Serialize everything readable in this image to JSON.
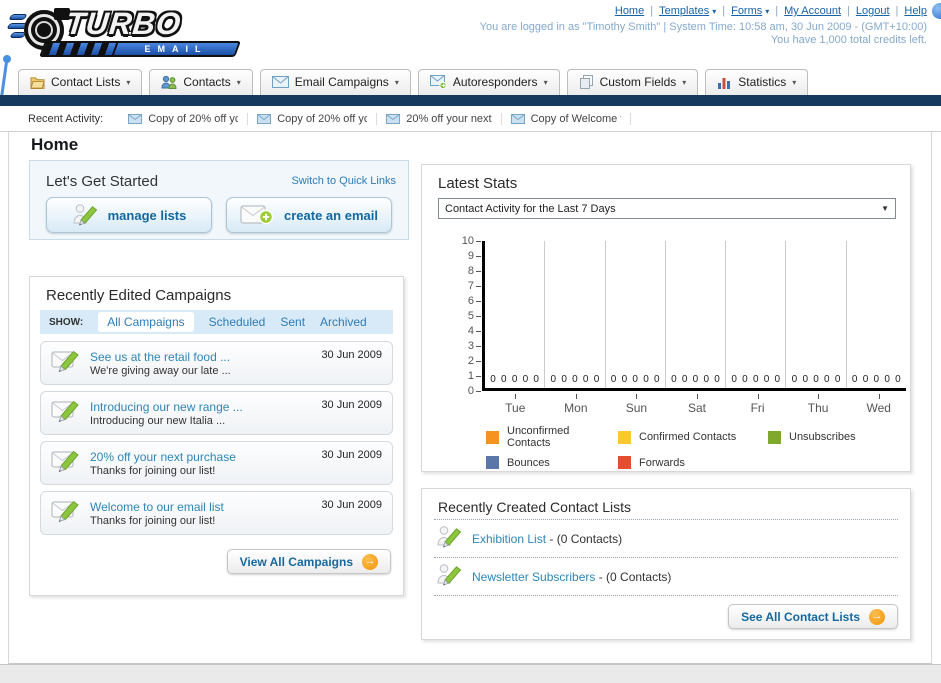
{
  "header": {
    "logo_text": "TURBO",
    "logo_sub": "EMAIL",
    "links": [
      "Home",
      "Templates",
      "Forms",
      "My Account",
      "Logout",
      "Help"
    ],
    "dropdown_links": [
      "Templates",
      "Forms"
    ],
    "separator": "|",
    "login_line": "You are logged in as \"Timothy Smith\" | System Time: 10:58 am, 30 Jun 2009 - (GMT+10:00)",
    "credits_line": "You have 1,000 total credits left."
  },
  "nav": {
    "tabs": [
      {
        "label": "Contact Lists",
        "icon": "folder-icon"
      },
      {
        "label": "Contacts",
        "icon": "contacts-icon"
      },
      {
        "label": "Email Campaigns",
        "icon": "envelope-icon"
      },
      {
        "label": "Autoresponders",
        "icon": "autoresponder-icon"
      },
      {
        "label": "Custom Fields",
        "icon": "custom-fields-icon"
      },
      {
        "label": "Statistics",
        "icon": "statistics-icon"
      }
    ]
  },
  "recent_activity": {
    "label": "Recent Activity:",
    "items": [
      "Copy of 20% off yc",
      "Copy of 20% off yc",
      "20% off your next",
      "Copy of Welcome tc"
    ]
  },
  "page_title": "Home",
  "get_started": {
    "title": "Let's Get Started",
    "switch_link": "Switch to Quick Links",
    "buttons": [
      {
        "label": "manage lists",
        "icon": "list-edit-icon"
      },
      {
        "label": "create an email",
        "icon": "create-email-icon"
      }
    ]
  },
  "campaigns": {
    "title": "Recently Edited Campaigns",
    "show_label": "SHOW:",
    "filters": [
      "All Campaigns",
      "Scheduled",
      "Sent",
      "Archived"
    ],
    "active_filter": "All Campaigns",
    "items": [
      {
        "title": "See us at the retail food ...",
        "subtitle": "We're giving away our late ...",
        "date": "30 Jun 2009"
      },
      {
        "title": "Introducing our new range ...",
        "subtitle": "Introducing our new Italia ...",
        "date": "30 Jun 2009"
      },
      {
        "title": "20% off your next purchase",
        "subtitle": "Thanks for joining our list!",
        "date": "30 Jun 2009"
      },
      {
        "title": "Welcome to our email list",
        "subtitle": "Thanks for joining our list!",
        "date": "30 Jun 2009"
      }
    ],
    "view_all_label": "View All Campaigns"
  },
  "stats": {
    "title": "Latest Stats",
    "dropdown_value": "Contact Activity for the Last 7 Days"
  },
  "chart_data": {
    "type": "bar",
    "title": "Contact Activity for the Last 7 Days",
    "categories": [
      "Tue",
      "Mon",
      "Sun",
      "Sat",
      "Fri",
      "Thu",
      "Wed"
    ],
    "series": [
      {
        "name": "Unconfirmed Contacts",
        "color": "#F6921E",
        "values": [
          0,
          0,
          0,
          0,
          0,
          0,
          0
        ]
      },
      {
        "name": "Confirmed Contacts",
        "color": "#FBC92B",
        "values": [
          0,
          0,
          0,
          0,
          0,
          0,
          0
        ]
      },
      {
        "name": "Unsubscribes",
        "color": "#7FA82C",
        "values": [
          0,
          0,
          0,
          0,
          0,
          0,
          0
        ]
      },
      {
        "name": "Bounces",
        "color": "#5B76A8",
        "values": [
          0,
          0,
          0,
          0,
          0,
          0,
          0
        ]
      },
      {
        "name": "Forwards",
        "color": "#E64D2E",
        "values": [
          0,
          0,
          0,
          0,
          0,
          0,
          0
        ]
      }
    ],
    "ylim": [
      0,
      10
    ],
    "yticks": [
      0,
      1,
      2,
      3,
      4,
      5,
      6,
      7,
      8,
      9,
      10
    ],
    "grid": true,
    "legend_position": "bottom",
    "xlabel": "",
    "ylabel": ""
  },
  "contact_lists": {
    "title": "Recently Created Contact Lists",
    "items": [
      {
        "name": "Exhibition List",
        "detail": "- (0 Contacts)"
      },
      {
        "name": "Newsletter Subscribers",
        "detail": "- (0 Contacts)"
      }
    ],
    "see_all_label": "See All Contact Lists"
  }
}
